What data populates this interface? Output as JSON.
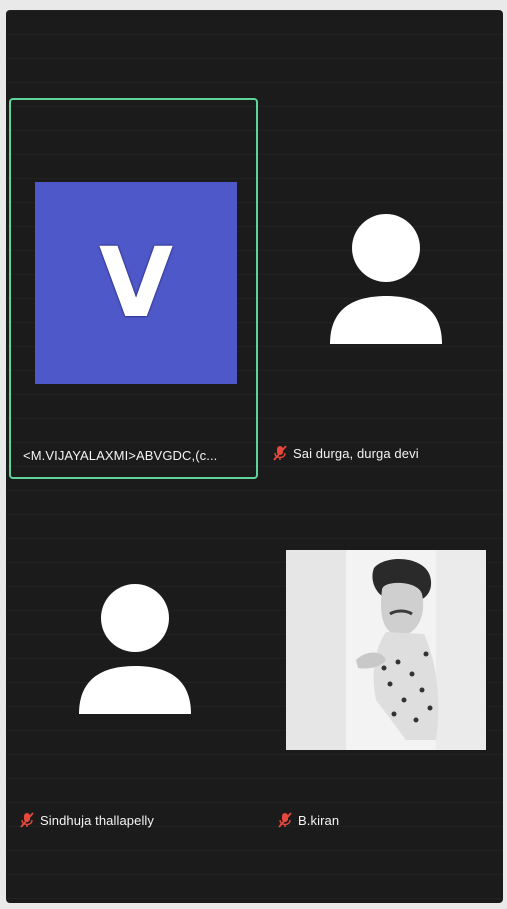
{
  "participants": [
    {
      "name": "<M.VIJAYALAXMI>ABVGDC,(c...",
      "avatar_letter": "V",
      "avatar_color": "#4f58c8",
      "active_speaker": true,
      "muted": false
    },
    {
      "name": "Sai durga, durga devi",
      "avatar_icon": "person-icon",
      "muted": true
    },
    {
      "name": "Sindhuja thallapelly",
      "avatar_icon": "person-icon",
      "muted": true
    },
    {
      "name": "B.kiran",
      "avatar_icon": "profile-photo",
      "muted": true
    }
  ],
  "colors": {
    "active_border": "#5ed39a",
    "background": "#1b1b1b",
    "mic_off": "#e5483c"
  }
}
